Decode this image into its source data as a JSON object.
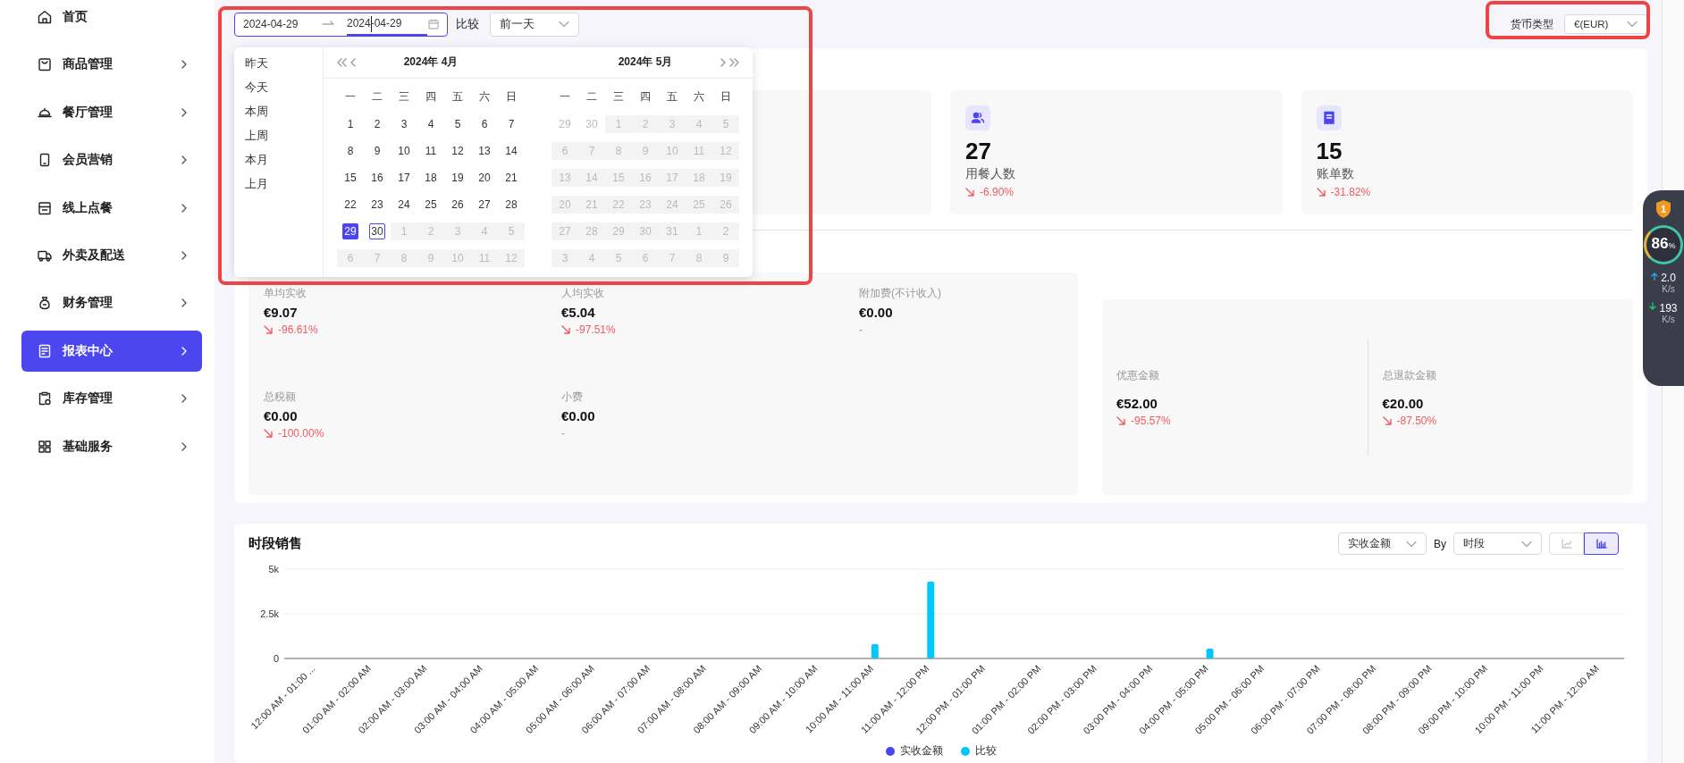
{
  "sidebar": {
    "items": [
      {
        "kind": "home",
        "label": "首页",
        "has_children": false,
        "selected": false
      },
      {
        "kind": "bag",
        "label": "商品管理",
        "has_children": true,
        "selected": false
      },
      {
        "kind": "cloche",
        "label": "餐厅管理",
        "has_children": true,
        "selected": false
      },
      {
        "kind": "phone",
        "label": "会员营销",
        "has_children": true,
        "selected": false
      },
      {
        "kind": "store",
        "label": "线上点餐",
        "has_children": true,
        "selected": false
      },
      {
        "kind": "truck",
        "label": "外卖及配送",
        "has_children": true,
        "selected": false
      },
      {
        "kind": "moneybag",
        "label": "财务管理",
        "has_children": true,
        "selected": false
      },
      {
        "kind": "report",
        "label": "报表中心",
        "has_children": true,
        "selected": true
      },
      {
        "kind": "inventory",
        "label": "库存管理",
        "has_children": true,
        "selected": false
      },
      {
        "kind": "grid",
        "label": "基础服务",
        "has_children": true,
        "selected": false
      }
    ]
  },
  "toolbar": {
    "date_range": {
      "start": "2024-04-29",
      "end": "2024-04-29",
      "end_focused": true,
      "highlighted": true
    },
    "compare": {
      "label": "比较",
      "value": "前一天"
    },
    "currency": {
      "label": "货币类型",
      "value": "€(EUR)",
      "highlighted": true
    }
  },
  "date_picker": {
    "presets": [
      {
        "label": "昨天"
      },
      {
        "label": "今天"
      },
      {
        "label": "本周"
      },
      {
        "label": "上周"
      },
      {
        "label": "本月"
      },
      {
        "label": "上月"
      }
    ],
    "months": [
      {
        "title": "2024年  4月",
        "kind": "prev",
        "weekdays": [
          "一",
          "二",
          "三",
          "四",
          "五",
          "六",
          "日"
        ],
        "weeks": [
          [
            {
              "day": "1",
              "kind": "normal",
              "selected": false,
              "today": false
            },
            {
              "day": "2",
              "kind": "normal",
              "selected": false,
              "today": false
            },
            {
              "day": "3",
              "kind": "normal",
              "selected": false,
              "today": false
            },
            {
              "day": "4",
              "kind": "normal",
              "selected": false,
              "today": false
            },
            {
              "day": "5",
              "kind": "normal",
              "selected": false,
              "today": false
            },
            {
              "day": "6",
              "kind": "normal",
              "selected": false,
              "today": false
            },
            {
              "day": "7",
              "kind": "normal",
              "selected": false,
              "today": false
            }
          ],
          [
            {
              "day": "8",
              "kind": "normal",
              "selected": false,
              "today": false
            },
            {
              "day": "9",
              "kind": "normal",
              "selected": false,
              "today": false
            },
            {
              "day": "10",
              "kind": "normal",
              "selected": false,
              "today": false
            },
            {
              "day": "11",
              "kind": "normal",
              "selected": false,
              "today": false
            },
            {
              "day": "12",
              "kind": "normal",
              "selected": false,
              "today": false
            },
            {
              "day": "13",
              "kind": "normal",
              "selected": false,
              "today": false
            },
            {
              "day": "14",
              "kind": "normal",
              "selected": false,
              "today": false
            }
          ],
          [
            {
              "day": "15",
              "kind": "normal",
              "selected": false,
              "today": false
            },
            {
              "day": "16",
              "kind": "normal",
              "selected": false,
              "today": false
            },
            {
              "day": "17",
              "kind": "normal",
              "selected": false,
              "today": false
            },
            {
              "day": "18",
              "kind": "normal",
              "selected": false,
              "today": false
            },
            {
              "day": "19",
              "kind": "normal",
              "selected": false,
              "today": false
            },
            {
              "day": "20",
              "kind": "normal",
              "selected": false,
              "today": false
            },
            {
              "day": "21",
              "kind": "normal",
              "selected": false,
              "today": false
            }
          ],
          [
            {
              "day": "22",
              "kind": "normal",
              "selected": false,
              "today": false
            },
            {
              "day": "23",
              "kind": "normal",
              "selected": false,
              "today": false
            },
            {
              "day": "24",
              "kind": "normal",
              "selected": false,
              "today": false
            },
            {
              "day": "25",
              "kind": "normal",
              "selected": false,
              "today": false
            },
            {
              "day": "26",
              "kind": "normal",
              "selected": false,
              "today": false
            },
            {
              "day": "27",
              "kind": "normal",
              "selected": false,
              "today": false
            },
            {
              "day": "28",
              "kind": "normal",
              "selected": false,
              "today": false
            }
          ],
          [
            {
              "day": "29",
              "kind": "normal",
              "selected": true,
              "today": false
            },
            {
              "day": "30",
              "kind": "normal",
              "selected": false,
              "today": true
            },
            {
              "day": "1",
              "kind": "disabled",
              "selected": false,
              "today": false
            },
            {
              "day": "2",
              "kind": "disabled",
              "selected": false,
              "today": false
            },
            {
              "day": "3",
              "kind": "disabled",
              "selected": false,
              "today": false
            },
            {
              "day": "4",
              "kind": "disabled",
              "selected": false,
              "today": false
            },
            {
              "day": "5",
              "kind": "disabled",
              "selected": false,
              "today": false
            }
          ],
          [
            {
              "day": "6",
              "kind": "disabled",
              "selected": false,
              "today": false
            },
            {
              "day": "7",
              "kind": "disabled",
              "selected": false,
              "today": false
            },
            {
              "day": "8",
              "kind": "disabled",
              "selected": false,
              "today": false
            },
            {
              "day": "9",
              "kind": "disabled",
              "selected": false,
              "today": false
            },
            {
              "day": "10",
              "kind": "disabled",
              "selected": false,
              "today": false
            },
            {
              "day": "11",
              "kind": "disabled",
              "selected": false,
              "today": false
            },
            {
              "day": "12",
              "kind": "disabled",
              "selected": false,
              "today": false
            }
          ]
        ]
      },
      {
        "title": "2024年  5月",
        "kind": "next",
        "weekdays": [
          "一",
          "二",
          "三",
          "四",
          "五",
          "六",
          "日"
        ],
        "weeks": [
          [
            {
              "day": "29",
              "kind": "outside",
              "selected": false,
              "today": false
            },
            {
              "day": "30",
              "kind": "outside",
              "selected": false,
              "today": false
            },
            {
              "day": "1",
              "kind": "disabled",
              "selected": false,
              "today": false
            },
            {
              "day": "2",
              "kind": "disabled",
              "selected": false,
              "today": false
            },
            {
              "day": "3",
              "kind": "disabled",
              "selected": false,
              "today": false
            },
            {
              "day": "4",
              "kind": "disabled",
              "selected": false,
              "today": false
            },
            {
              "day": "5",
              "kind": "disabled",
              "selected": false,
              "today": false
            }
          ],
          [
            {
              "day": "6",
              "kind": "disabled",
              "selected": false,
              "today": false
            },
            {
              "day": "7",
              "kind": "disabled",
              "selected": false,
              "today": false
            },
            {
              "day": "8",
              "kind": "disabled",
              "selected": false,
              "today": false
            },
            {
              "day": "9",
              "kind": "disabled",
              "selected": false,
              "today": false
            },
            {
              "day": "10",
              "kind": "disabled",
              "selected": false,
              "today": false
            },
            {
              "day": "11",
              "kind": "disabled",
              "selected": false,
              "today": false
            },
            {
              "day": "12",
              "kind": "disabled",
              "selected": false,
              "today": false
            }
          ],
          [
            {
              "day": "13",
              "kind": "disabled",
              "selected": false,
              "today": false
            },
            {
              "day": "14",
              "kind": "disabled",
              "selected": false,
              "today": false
            },
            {
              "day": "15",
              "kind": "disabled",
              "selected": false,
              "today": false
            },
            {
              "day": "16",
              "kind": "disabled",
              "selected": false,
              "today": false
            },
            {
              "day": "17",
              "kind": "disabled",
              "selected": false,
              "today": false
            },
            {
              "day": "18",
              "kind": "disabled",
              "selected": false,
              "today": false
            },
            {
              "day": "19",
              "kind": "disabled",
              "selected": false,
              "today": false
            }
          ],
          [
            {
              "day": "20",
              "kind": "disabled",
              "selected": false,
              "today": false
            },
            {
              "day": "21",
              "kind": "disabled",
              "selected": false,
              "today": false
            },
            {
              "day": "22",
              "kind": "disabled",
              "selected": false,
              "today": false
            },
            {
              "day": "23",
              "kind": "disabled",
              "selected": false,
              "today": false
            },
            {
              "day": "24",
              "kind": "disabled",
              "selected": false,
              "today": false
            },
            {
              "day": "25",
              "kind": "disabled",
              "selected": false,
              "today": false
            },
            {
              "day": "26",
              "kind": "disabled",
              "selected": false,
              "today": false
            }
          ],
          [
            {
              "day": "27",
              "kind": "disabled",
              "selected": false,
              "today": false
            },
            {
              "day": "28",
              "kind": "disabled",
              "selected": false,
              "today": false
            },
            {
              "day": "29",
              "kind": "disabled",
              "selected": false,
              "today": false
            },
            {
              "day": "30",
              "kind": "disabled",
              "selected": false,
              "today": false
            },
            {
              "day": "31",
              "kind": "disabled",
              "selected": false,
              "today": false
            },
            {
              "day": "1",
              "kind": "disabled",
              "selected": false,
              "today": false
            },
            {
              "day": "2",
              "kind": "disabled",
              "selected": false,
              "today": false
            }
          ],
          [
            {
              "day": "3",
              "kind": "disabled",
              "selected": false,
              "today": false
            },
            {
              "day": "4",
              "kind": "disabled",
              "selected": false,
              "today": false
            },
            {
              "day": "5",
              "kind": "disabled",
              "selected": false,
              "today": false
            },
            {
              "day": "6",
              "kind": "disabled",
              "selected": false,
              "today": false
            },
            {
              "day": "7",
              "kind": "disabled",
              "selected": false,
              "today": false
            },
            {
              "day": "8",
              "kind": "disabled",
              "selected": false,
              "today": false
            },
            {
              "day": "9",
              "kind": "disabled",
              "selected": false,
              "today": false
            }
          ]
        ]
      }
    ]
  },
  "summary_cards": [
    {
      "kind": "diners",
      "value": "27",
      "label": "用餐人数",
      "change": {
        "kind": "down",
        "text": "-6.90%"
      }
    },
    {
      "kind": "bills",
      "value": "15",
      "label": "账单数",
      "change": {
        "kind": "down",
        "text": "-31.82%"
      }
    }
  ],
  "metrics": [
    {
      "label": "单均实收",
      "value": "€9.07",
      "change": {
        "kind": "down",
        "text": "-96.61%"
      }
    },
    {
      "label": "人均实收",
      "value": "€5.04",
      "change": {
        "kind": "down",
        "text": "-97.51%"
      }
    },
    {
      "label": "附加费(不计收入)",
      "value": "€0.00",
      "change": {
        "kind": "none",
        "text": "-"
      }
    },
    {
      "label": "总税额",
      "value": "€0.00",
      "change": {
        "kind": "down",
        "text": "-100.00%"
      }
    },
    {
      "label": "小费",
      "value": "€0.00",
      "change": {
        "kind": "none",
        "text": "-"
      }
    }
  ],
  "side_metrics": [
    {
      "label": "优惠金额",
      "value": "€52.00",
      "change": {
        "kind": "down",
        "text": "-95.57%"
      }
    },
    {
      "label": "总退款金额",
      "value": "€20.00",
      "change": {
        "kind": "down",
        "text": "-87.50%"
      }
    }
  ],
  "hourly_sales": {
    "title": "时段销售",
    "metric_select": "实收金额",
    "by_label": "By",
    "group_select": "时段",
    "chart_types": [
      {
        "kind": "line",
        "selected": false
      },
      {
        "kind": "bar",
        "selected": true
      }
    ],
    "chart_data": {
      "type": "bar",
      "categories": [
        "12:00 AM - 01:00 ...",
        "01:00 AM - 02:00 AM",
        "02:00 AM - 03:00 AM",
        "03:00 AM - 04:00 AM",
        "04:00 AM - 05:00 AM",
        "05:00 AM - 06:00 AM",
        "06:00 AM - 07:00 AM",
        "07:00 AM - 08:00 AM",
        "08:00 AM - 09:00 AM",
        "09:00 AM - 10:00 AM",
        "10:00 AM - 11:00 AM",
        "11:00 AM - 12:00 PM",
        "12:00 PM - 01:00 PM",
        "01:00 PM - 02:00 PM",
        "02:00 PM - 03:00 PM",
        "03:00 PM - 04:00 PM",
        "04:00 PM - 05:00 PM",
        "05:00 PM - 06:00 PM",
        "06:00 PM - 07:00 PM",
        "07:00 PM - 08:00 PM",
        "08:00 PM - 09:00 PM",
        "09:00 PM - 10:00 PM",
        "10:00 PM - 11:00 PM",
        "11:00 PM - 12:00 AM"
      ],
      "series": [
        {
          "name": "实收金额",
          "color": "#4a45f0",
          "values": [
            0,
            0,
            0,
            0,
            0,
            0,
            0,
            0,
            0,
            0,
            0,
            0,
            0,
            0,
            0,
            0,
            0,
            0,
            0,
            0,
            0,
            0,
            0,
            0
          ]
        },
        {
          "name": "比较",
          "color": "#00c8ff",
          "values": [
            0,
            0,
            0,
            0,
            0,
            0,
            0,
            0,
            0,
            0,
            800,
            4300,
            0,
            0,
            0,
            0,
            550,
            0,
            0,
            0,
            0,
            0,
            0,
            0
          ]
        }
      ],
      "ylim": [
        0,
        5000
      ],
      "yticks": [
        0,
        {
          "value": 2500,
          "label": "2.5k"
        },
        {
          "value": 5000,
          "label": "5k"
        }
      ]
    }
  },
  "monitor": {
    "badge": "1",
    "percent": "86",
    "percent_unit": "%",
    "upload": "2.0",
    "upload_unit": "K/s",
    "download": "193",
    "download_unit": "K/s"
  }
}
